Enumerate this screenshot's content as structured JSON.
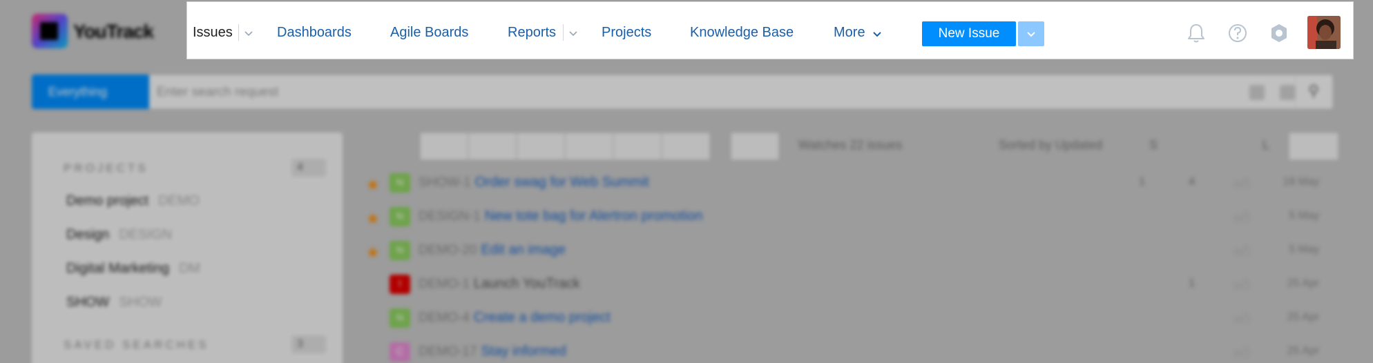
{
  "app": {
    "name": "YouTrack"
  },
  "header": {
    "nav": [
      {
        "label": "Issues",
        "has_dropdown": true,
        "active": true
      },
      {
        "label": "Dashboards",
        "has_dropdown": false,
        "active": false
      },
      {
        "label": "Agile Boards",
        "has_dropdown": false,
        "active": false
      },
      {
        "label": "Reports",
        "has_dropdown": true,
        "active": false
      },
      {
        "label": "Projects",
        "has_dropdown": false,
        "active": false
      },
      {
        "label": "Knowledge Base",
        "has_dropdown": false,
        "active": false
      },
      {
        "label": "More",
        "has_dropdown": true,
        "active": false
      }
    ],
    "new_issue_label": "New Issue",
    "icons": [
      "bell-icon",
      "help-icon",
      "settings-icon",
      "avatar"
    ]
  },
  "search": {
    "scope_label": "Everything",
    "placeholder": "Enter search request"
  },
  "toolbar": {
    "matches_text": "Watches 22 issues",
    "sort_text": "Sorted by Updated",
    "size_small": "S",
    "size_large": "L"
  },
  "sidebar": {
    "projects_header": "PROJECTS",
    "projects_count": "4",
    "projects": [
      {
        "name": "Demo project",
        "key": "DEMO"
      },
      {
        "name": "Design",
        "key": "DESIGN"
      },
      {
        "name": "Digital Marketing",
        "key": "DM"
      },
      {
        "name": "SHOW",
        "key": "SHOW"
      }
    ],
    "saved_header": "SAVED SEARCHES",
    "saved_count": "3"
  },
  "issues": [
    {
      "id": "SHOW-1",
      "summary": "Order swag for Web Summit",
      "starred": true,
      "priority": "N",
      "attachments": "1",
      "comments": "4",
      "date": "18 May",
      "resolved": false
    },
    {
      "id": "DESIGN-1",
      "summary": "New tote bag for Alertron promotion",
      "starred": true,
      "priority": "N",
      "attachments": "",
      "comments": "",
      "date": "5 May",
      "resolved": false
    },
    {
      "id": "DEMO-20",
      "summary": "Edit an image",
      "starred": true,
      "priority": "N",
      "attachments": "",
      "comments": "",
      "date": "5 May",
      "resolved": false
    },
    {
      "id": "DEMO-1",
      "summary": "Launch YouTrack",
      "starred": false,
      "priority": "!",
      "attachments": "",
      "comments": "1",
      "date": "25 Apr",
      "resolved": true
    },
    {
      "id": "DEMO-4",
      "summary": "Create a demo project",
      "starred": false,
      "priority": "N",
      "attachments": "",
      "comments": "",
      "date": "25 Apr",
      "resolved": false
    },
    {
      "id": "DEMO-17",
      "summary": "Stay informed",
      "starred": false,
      "priority": "C",
      "attachments": "",
      "comments": "",
      "date": "25 Apr",
      "resolved": false
    }
  ],
  "colors": {
    "accent": "#008eff",
    "link": "#1a5fa8",
    "star": "#ff8c00",
    "normal_priority": "#8cd15e",
    "critical_priority": "#e30000",
    "cosmetic_priority": "#e68cd4"
  }
}
